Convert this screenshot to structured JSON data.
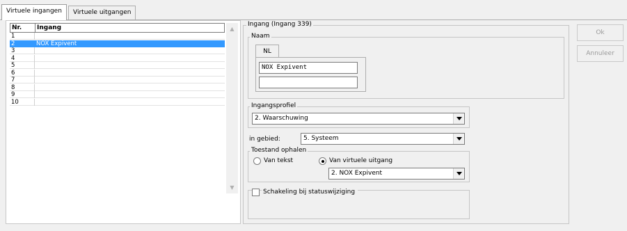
{
  "tabs": [
    {
      "label": "Virtuele ingangen"
    },
    {
      "label": "Virtuele uitgangen"
    }
  ],
  "list": {
    "headers": [
      "Nr.",
      "Ingang"
    ],
    "rows": [
      {
        "nr": "1",
        "ingang": ""
      },
      {
        "nr": "2",
        "ingang": "NOX Expivent"
      },
      {
        "nr": "3",
        "ingang": ""
      },
      {
        "nr": "4",
        "ingang": ""
      },
      {
        "nr": "5",
        "ingang": ""
      },
      {
        "nr": "6",
        "ingang": ""
      },
      {
        "nr": "7",
        "ingang": ""
      },
      {
        "nr": "8",
        "ingang": ""
      },
      {
        "nr": "9",
        "ingang": ""
      },
      {
        "nr": "10",
        "ingang": ""
      }
    ],
    "selected_index": 1
  },
  "detail": {
    "group_title": "Ingang (Ingang 339)",
    "naam": {
      "legend": "Naam",
      "lang_tab": "NL",
      "name_value": "NOX Expivent",
      "name2_value": ""
    },
    "ingangsprofiel": {
      "legend": "Ingangsprofiel",
      "selected": "2. Waarschuwing"
    },
    "gebied": {
      "label": "in gebied:",
      "selected": "5. Systeem"
    },
    "toestand": {
      "legend": "Toestand ophalen",
      "option_text": "Van tekst",
      "option_virtual": "Van virtuele uitgang",
      "virtual_selected": "2. NOX Expivent",
      "checked": "virtual"
    },
    "schakeling": {
      "label": "Schakeling bij statuswijziging",
      "checked": false
    }
  },
  "buttons": {
    "ok": "Ok",
    "cancel": "Annuleer"
  }
}
